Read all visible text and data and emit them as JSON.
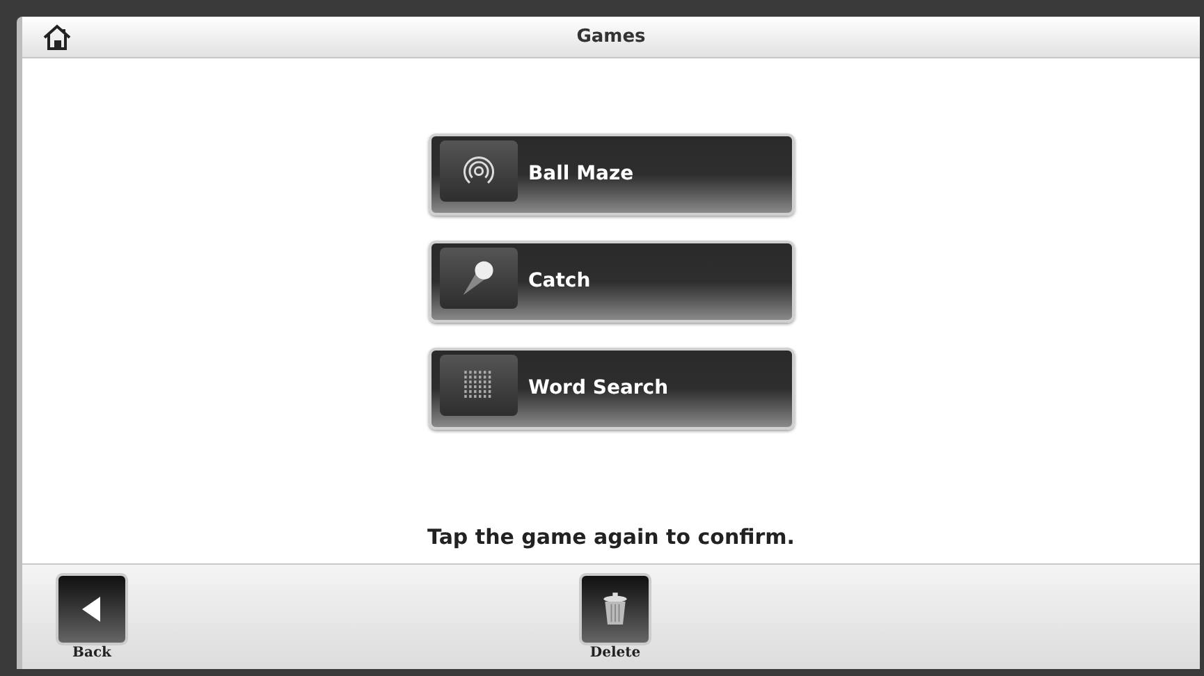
{
  "header": {
    "title": "Games"
  },
  "games": [
    {
      "label": "Ball Maze",
      "kind": "maze"
    },
    {
      "label": "Catch",
      "kind": "catch"
    },
    {
      "label": "Word Search",
      "kind": "word_search"
    }
  ],
  "message": "Tap the game again to confirm.",
  "footer": [
    {
      "label": "Back",
      "kind": "back"
    },
    {
      "label": "Delete",
      "kind": "delete"
    }
  ]
}
